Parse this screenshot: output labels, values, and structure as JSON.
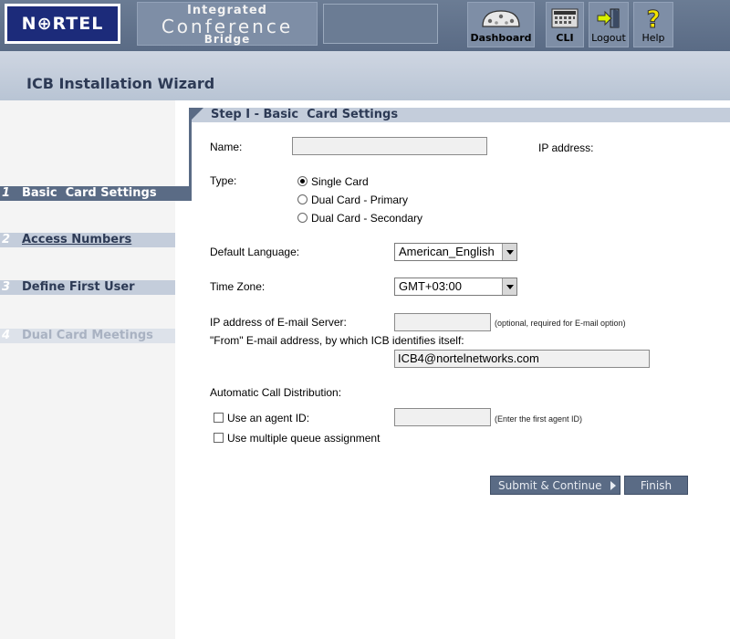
{
  "header": {
    "logo_text": "N⊕RTEL",
    "brand_line1": "Integrated",
    "brand_line2": "Conference",
    "brand_line3": "Bridge",
    "tools": [
      {
        "label": "Dashboard",
        "icon": "dashboard-gauge-icon"
      },
      {
        "label": "CLI",
        "icon": "cli-keyboard-icon"
      },
      {
        "label": "Logout",
        "icon": "logout-door-icon"
      },
      {
        "label": "Help",
        "icon": "help-question-icon"
      }
    ]
  },
  "page": {
    "title": "ICB Installation Wizard"
  },
  "nav": {
    "items": [
      {
        "num": "1",
        "label": "Basic  Card Settings",
        "state": "active"
      },
      {
        "num": "2",
        "label": "Access Numbers",
        "state": "link"
      },
      {
        "num": "3",
        "label": "Define First User",
        "state": "normal"
      },
      {
        "num": "4",
        "label": "Dual Card Meetings",
        "state": "disabled"
      }
    ]
  },
  "step": {
    "heading": "Step I - Basic  Card Settings"
  },
  "form": {
    "name_label": "Name:",
    "name_value": "",
    "ip_label": "IP address:",
    "type_label": "Type:",
    "type_options": [
      "Single Card",
      "Dual Card - Primary",
      "Dual Card - Secondary"
    ],
    "type_selected": "Single Card",
    "language_label": "Default Language:",
    "language_value": "American_English",
    "timezone_label": "Time Zone:",
    "timezone_value": "GMT+03:00",
    "email_server_label": "IP address of E-mail Server:",
    "email_server_value": "",
    "email_server_hint": "(optional, required for E-mail option)",
    "from_label": "\"From\" E-mail address, by which ICB identifies itself:",
    "from_value": "ICB4@nortelnetworks.com",
    "acd_label": "Automatic Call Distribution:",
    "agent_label": "Use an agent ID:",
    "agent_value": "",
    "agent_hint": "(Enter the first agent ID)",
    "queue_label": "Use multiple queue assignment",
    "agent_checked": false,
    "queue_checked": false
  },
  "buttons": {
    "submit": "Submit & Continue",
    "finish": "Finish"
  },
  "colors": {
    "header_bg": "#5a6b85",
    "nav_active": "#5a6b85",
    "nav_bar": "#c4cddb",
    "logo_bg": "#1c2b7a"
  }
}
